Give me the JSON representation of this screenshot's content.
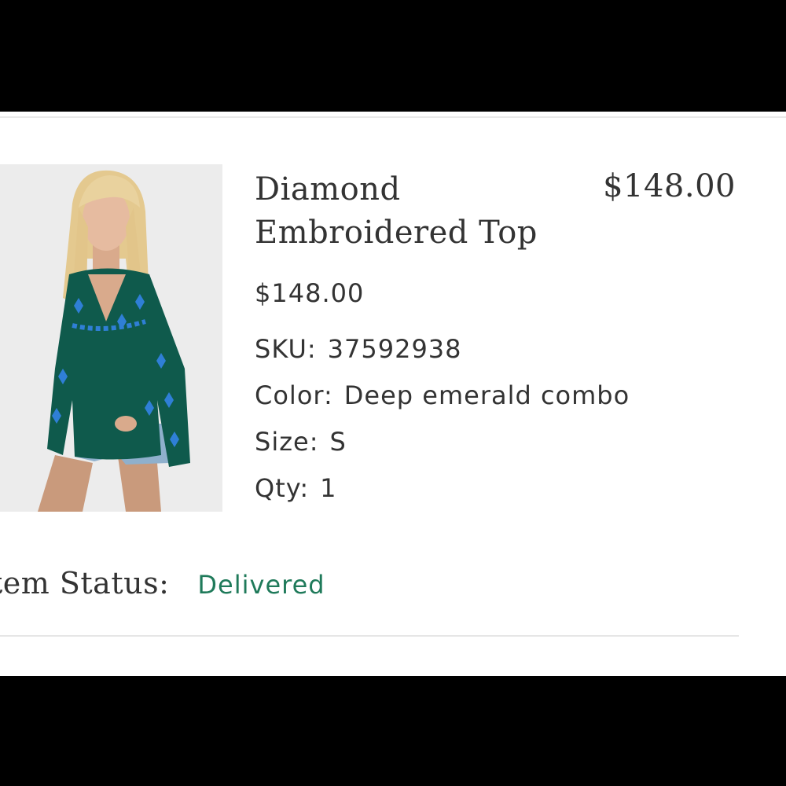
{
  "product": {
    "name_line1": "Diamond",
    "name_line2": "Embroidered Top",
    "header_price": "$148.00",
    "price": "$148.00",
    "sku_label": "SKU:",
    "sku_value": "37592938",
    "color_label": "Color:",
    "color_value": "Deep emerald combo",
    "size_label": "Size:",
    "size_value": "S",
    "qty_label": "Qty:",
    "qty_value": "1"
  },
  "status": {
    "label": "tem Status:",
    "value": "Delivered"
  },
  "colors": {
    "status_delivered": "#1f7a5a",
    "text": "#333333",
    "product_top": "#0f5a4c",
    "embroidery": "#2f7fd6"
  }
}
